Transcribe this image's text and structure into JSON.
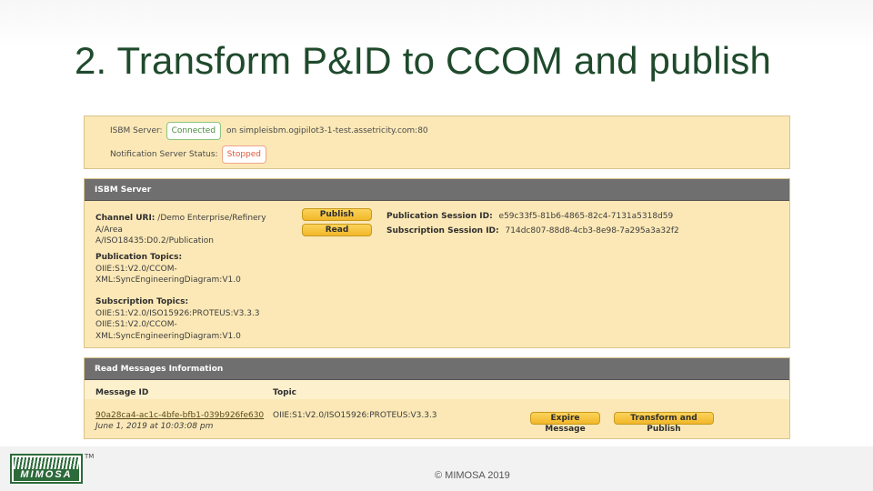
{
  "slide": {
    "title": "2. Transform P&ID to CCOM and publish",
    "copyright": "© MIMOSA 2019",
    "logo_text": "MIMOSA",
    "tm": "TM"
  },
  "status": {
    "isbm_label": "ISBM Server:",
    "isbm_state": "Connected",
    "isbm_host": "on simpleisbm.ogipilot3-1-test.assetricity.com:80",
    "notif_label": "Notification Server Status:",
    "notif_state": "Stopped",
    "colors": {
      "connected": "#4b8b3b",
      "stopped": "#e0573a"
    }
  },
  "isbm": {
    "header": "ISBM Server",
    "channel_label": "Channel URI:",
    "channel_value_1": "/Demo Enterprise/Refinery A/Area",
    "channel_value_2": "A/ISO18435:D0.2/Publication",
    "publish_button": "Publish",
    "read_button": "Read",
    "pub_session_label": "Publication Session ID:",
    "pub_session_value": "e59c33f5-81b6-4865-82c4-7131a5318d59",
    "sub_session_label": "Subscription Session ID:",
    "sub_session_value": "714dc807-88d8-4cb3-8e98-7a295a3a32f2",
    "pub_topics_label": "Publication Topics:",
    "pub_topics": [
      "OIIE:S1:V2.0/CCOM-",
      "XML:SyncEngineeringDiagram:V1.0"
    ],
    "sub_topics_label": "Subscription Topics:",
    "sub_topics": [
      "OIIE:S1:V2.0/ISO15926:PROTEUS:V3.3.3",
      "OIIE:S1:V2.0/CCOM-",
      "XML:SyncEngineeringDiagram:V1.0"
    ]
  },
  "read_messages": {
    "header": "Read Messages Information",
    "col_message_id": "Message ID",
    "col_topic": "Topic",
    "rows": [
      {
        "message_id": "90a28ca4-ac1c-4bfe-bfb1-039b926fe630",
        "date": "June 1, 2019 at 10:03:08 pm",
        "topic": "OIIE:S1:V2.0/ISO15926:PROTEUS:V3.3.3"
      }
    ],
    "expire_button": "Expire Message",
    "transform_button": "Transform and Publish"
  }
}
